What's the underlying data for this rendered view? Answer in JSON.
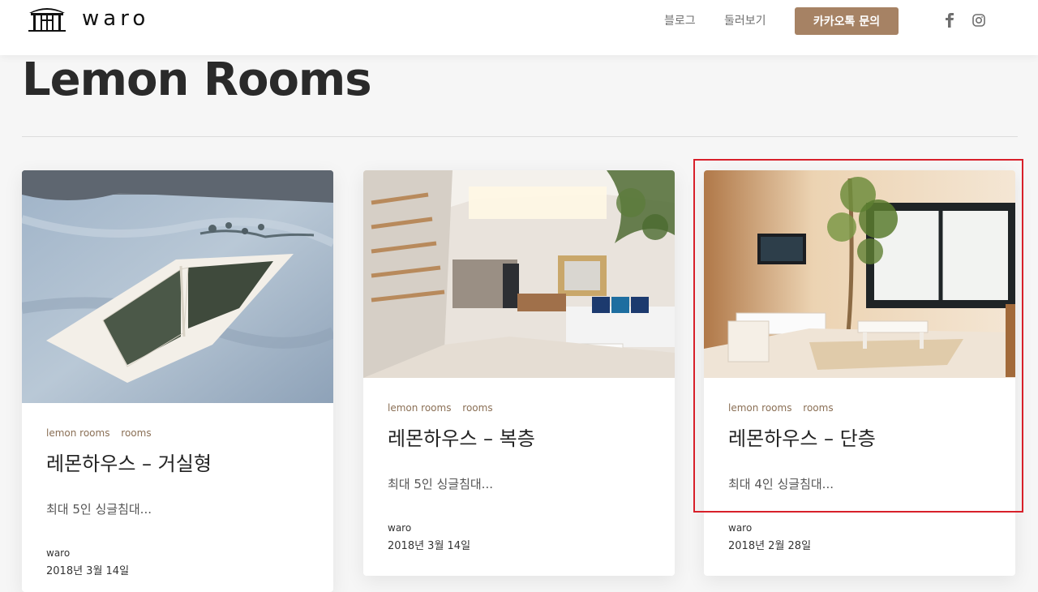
{
  "header": {
    "logo_text": "waro",
    "nav": [
      {
        "label": "블로그"
      },
      {
        "label": "둘러보기"
      }
    ],
    "cta_label": "카카오톡 문의",
    "social": [
      "facebook-icon",
      "instagram-icon"
    ]
  },
  "page": {
    "title": "Lemon Rooms"
  },
  "cards": [
    {
      "tags": [
        "lemon rooms",
        "rooms"
      ],
      "title": "레몬하우스 – 거실형",
      "excerpt": "최대 5인 싱글침대...",
      "author": "waro",
      "date": "2018년 3월 14일",
      "image": "bedroom-book-photo"
    },
    {
      "tags": [
        "lemon rooms",
        "rooms"
      ],
      "title": "레몬하우스 – 복층",
      "excerpt": "최대 5인 싱글침대...",
      "author": "waro",
      "date": "2018년 3월 14일",
      "image": "duplex-living-room-photo"
    },
    {
      "tags": [
        "lemon rooms",
        "rooms"
      ],
      "title": "레몬하우스 – 단층",
      "excerpt": "최대 4인 싱글침대...",
      "author": "waro",
      "date": "2018년 2월 28일",
      "image": "single-floor-living-room-photo"
    }
  ],
  "colors": {
    "accent": "#a68264",
    "highlight": "#d8202a",
    "tag": "#8a6f55"
  }
}
